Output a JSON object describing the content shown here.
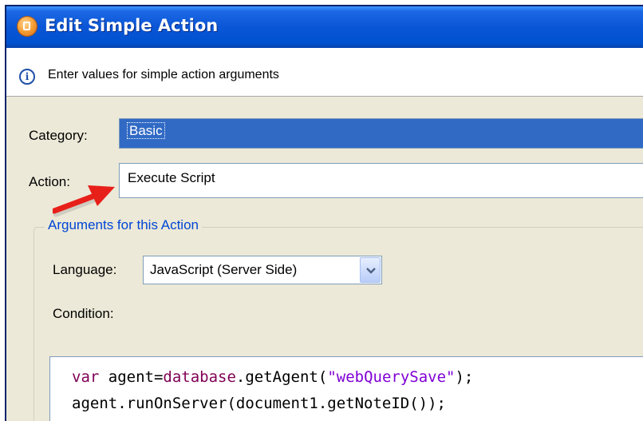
{
  "window": {
    "title": "Edit Simple Action"
  },
  "info": {
    "message": "Enter values for simple action arguments"
  },
  "form": {
    "category_label": "Category:",
    "category_value": "Basic",
    "action_label": "Action:",
    "action_value": "Execute Script"
  },
  "arguments": {
    "group_title": "Arguments for this Action",
    "language_label": "Language:",
    "language_value": "JavaScript (Server Side)",
    "condition_label": "Condition:"
  },
  "code": {
    "line1": {
      "kw": "var",
      "t1": " agent=",
      "obj": "database",
      "t2": ".getAgent(",
      "str": "\"webQuerySave\"",
      "t3": ");"
    },
    "line2": "agent.runOnServer(document1.getNoteID());"
  },
  "colors": {
    "titlebar": "#0a56d6",
    "selection": "#316ac5",
    "group_title": "#0046d5",
    "arrow": "#e8201a",
    "dialog_bg": "#ece9d8"
  },
  "icons": [
    "app-icon",
    "info-icon",
    "red-arrow-icon",
    "dropdown-arrow-icon"
  ]
}
